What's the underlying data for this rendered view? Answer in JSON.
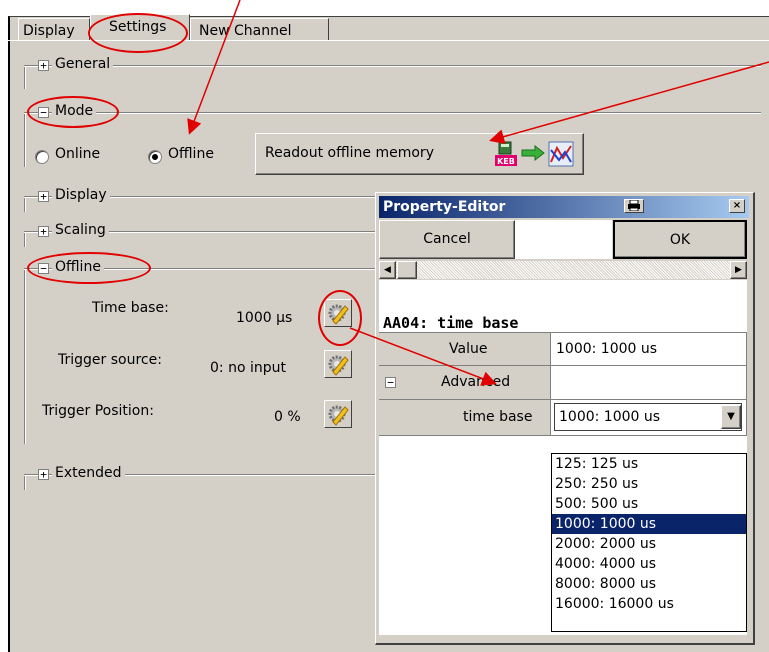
{
  "tabs": [
    {
      "label": "Display"
    },
    {
      "label": "Settings"
    },
    {
      "label": "New Channel"
    }
  ],
  "sections": {
    "general": {
      "label": "General",
      "toggle": "+"
    },
    "mode": {
      "label": "Mode",
      "toggle": "-"
    },
    "display": {
      "label": "Display",
      "toggle": "+"
    },
    "scaling": {
      "label": "Scaling",
      "toggle": "+"
    },
    "offline": {
      "label": "Offline",
      "toggle": "-"
    },
    "extended": {
      "label": "Extended",
      "toggle": "+"
    }
  },
  "mode": {
    "online_label": "Online",
    "offline_label": "Offline",
    "selected": "Offline",
    "readout_button": "Readout offline memory",
    "readout_icon_text": "KEB"
  },
  "offline_settings": [
    {
      "label": "Time base:",
      "value": "1000 µs"
    },
    {
      "label": "Trigger source:",
      "value": "0: no input"
    },
    {
      "label": "Trigger Position:",
      "value": "0 %"
    }
  ],
  "property_editor": {
    "title": "Property-Editor",
    "cancel_label": "Cancel",
    "ok_label": "OK",
    "parameter_title": "AA04: time base",
    "rows": {
      "value_label": "Value",
      "value": "1000: 1000 us",
      "advanced_toggle": "-",
      "advanced_label": "Advanced",
      "time_base_label": "time base",
      "time_base_value": "1000: 1000 us"
    },
    "dropdown_options": [
      "125: 125 us",
      "250: 250 us",
      "500: 500 us",
      "1000: 1000 us",
      "2000: 2000 us",
      "4000: 4000 us",
      "8000: 8000 us",
      "16000: 16000 us"
    ],
    "dropdown_selected": "1000: 1000 us"
  },
  "colors": {
    "window_bg": "#d4d0c8",
    "title_bar": "#0a246a",
    "selection": "#0a246a",
    "annotation": "#e00000"
  }
}
